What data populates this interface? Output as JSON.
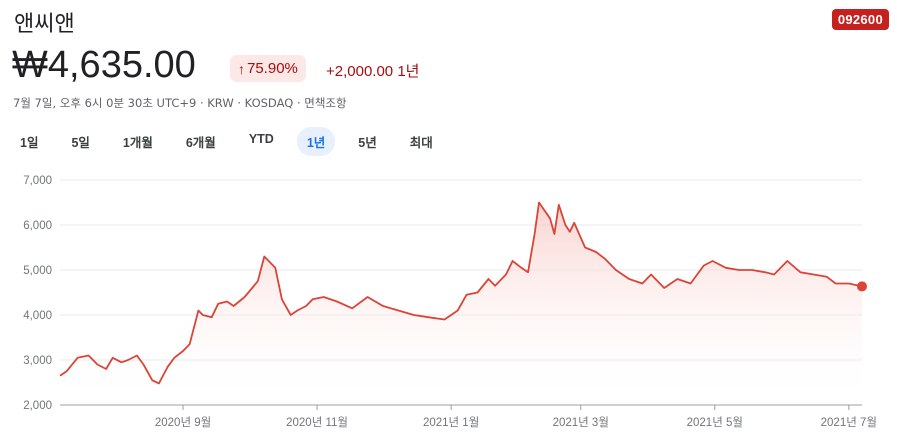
{
  "header": {
    "title": "앤씨앤",
    "ticker": "092600",
    "price": "₩4,635.00",
    "pct_arrow": "↑",
    "pct_change": "75.90%",
    "abs_change": "+2,000.00 1년",
    "meta": "7월 7일, 오후 6시 0분 30초 UTC+9 · KRW · KOSDAQ · 면책조항"
  },
  "ranges": [
    {
      "label": "1일",
      "active": false
    },
    {
      "label": "5일",
      "active": false
    },
    {
      "label": "1개월",
      "active": false
    },
    {
      "label": "6개월",
      "active": false
    },
    {
      "label": "YTD",
      "active": false
    },
    {
      "label": "1년",
      "active": true
    },
    {
      "label": "5년",
      "active": false
    },
    {
      "label": "최대",
      "active": false
    }
  ],
  "colors": {
    "line": "#db4437",
    "fill_top": "#f6c5c0",
    "ticker_bg": "#c5221f",
    "active_range": "#1a73e8"
  },
  "chart_data": {
    "type": "area",
    "title": "",
    "xlabel": "",
    "ylabel": "",
    "ylim": [
      2000,
      7000
    ],
    "yticks": [
      2000,
      3000,
      4000,
      5000,
      6000,
      7000
    ],
    "ytick_labels": [
      "2,000",
      "3,000",
      "4,000",
      "5,000",
      "6,000",
      "7,000"
    ],
    "xlim": [
      "2020-07-07",
      "2021-07-07"
    ],
    "xticks": [
      "2020-09-01",
      "2020-11-01",
      "2021-01-01",
      "2021-03-01",
      "2021-05-01",
      "2021-07-01"
    ],
    "xtick_labels": [
      "2020년 9월",
      "2020년 11월",
      "2021년 1월",
      "2021년 3월",
      "2021년 5월",
      "2021년 7월"
    ],
    "grid": true,
    "series": [
      {
        "name": "",
        "x": [
          "2020-07-07",
          "2020-07-10",
          "2020-07-15",
          "2020-07-20",
          "2020-07-24",
          "2020-07-28",
          "2020-07-31",
          "2020-08-04",
          "2020-08-07",
          "2020-08-11",
          "2020-08-14",
          "2020-08-18",
          "2020-08-21",
          "2020-08-25",
          "2020-08-28",
          "2020-09-01",
          "2020-09-04",
          "2020-09-08",
          "2020-09-10",
          "2020-09-14",
          "2020-09-17",
          "2020-09-21",
          "2020-09-24",
          "2020-09-29",
          "2020-10-05",
          "2020-10-08",
          "2020-10-13",
          "2020-10-16",
          "2020-10-20",
          "2020-10-23",
          "2020-10-27",
          "2020-10-30",
          "2020-11-04",
          "2020-11-10",
          "2020-11-17",
          "2020-11-24",
          "2020-12-01",
          "2020-12-08",
          "2020-12-15",
          "2020-12-22",
          "2020-12-29",
          "2021-01-04",
          "2021-01-08",
          "2021-01-13",
          "2021-01-18",
          "2021-01-21",
          "2021-01-26",
          "2021-01-29",
          "2021-02-02",
          "2021-02-05",
          "2021-02-08",
          "2021-02-10",
          "2021-02-15",
          "2021-02-17",
          "2021-02-19",
          "2021-02-22",
          "2021-02-24",
          "2021-02-26",
          "2021-03-03",
          "2021-03-08",
          "2021-03-12",
          "2021-03-17",
          "2021-03-23",
          "2021-03-29",
          "2021-04-02",
          "2021-04-08",
          "2021-04-14",
          "2021-04-20",
          "2021-04-26",
          "2021-04-30",
          "2021-05-06",
          "2021-05-12",
          "2021-05-18",
          "2021-05-24",
          "2021-05-28",
          "2021-06-03",
          "2021-06-09",
          "2021-06-15",
          "2021-06-21",
          "2021-06-25",
          "2021-07-01",
          "2021-07-07"
        ],
        "values": [
          2650,
          2750,
          3050,
          3100,
          2900,
          2800,
          3050,
          2950,
          3000,
          3100,
          2900,
          2550,
          2480,
          2850,
          3050,
          3200,
          3350,
          4100,
          4000,
          3950,
          4250,
          4300,
          4200,
          4400,
          4750,
          5300,
          5050,
          4350,
          4000,
          4100,
          4200,
          4350,
          4400,
          4300,
          4150,
          4400,
          4200,
          4100,
          4000,
          3950,
          3900,
          4100,
          4450,
          4500,
          4800,
          4650,
          4900,
          5200,
          5050,
          4950,
          5800,
          6500,
          6150,
          5800,
          6450,
          6000,
          5850,
          6050,
          5500,
          5400,
          5250,
          5000,
          4800,
          4700,
          4900,
          4600,
          4800,
          4700,
          5100,
          5200,
          5050,
          5000,
          5000,
          4950,
          4900,
          5200,
          4950,
          4900,
          4850,
          4700,
          4700,
          4635
        ]
      }
    ]
  }
}
